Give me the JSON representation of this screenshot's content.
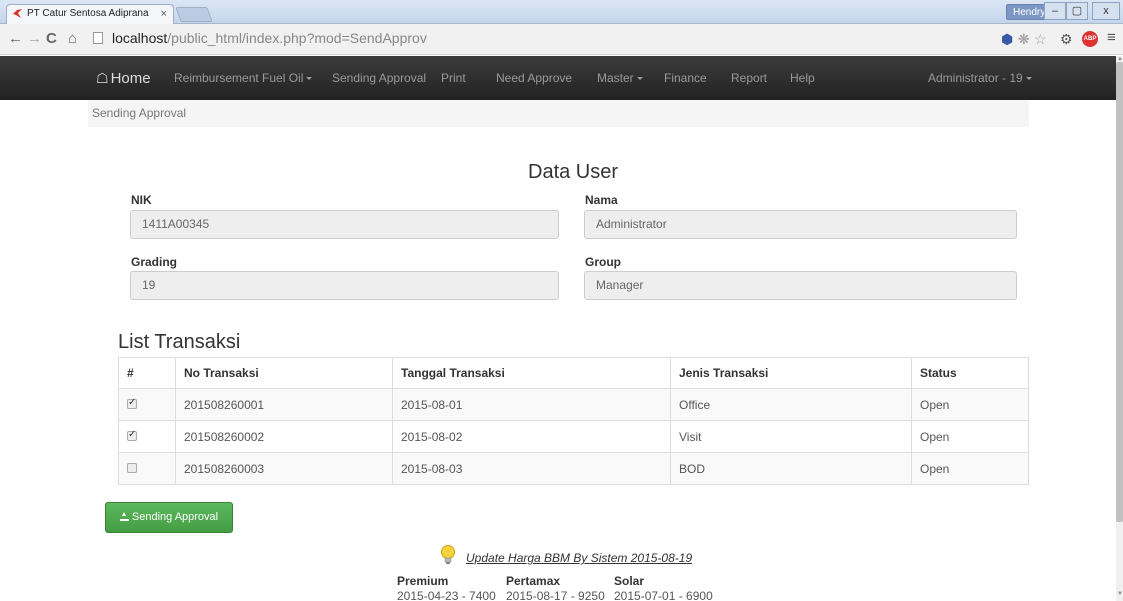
{
  "browser": {
    "tab_title": "PT Catur Sentosa Adiprana",
    "tab_close": "×",
    "user_badge": "Hendry",
    "win_min": "–",
    "win_max": "▢",
    "win_close": "x",
    "url_host": "localhost",
    "url_path": "/public_html/index.php?mod=SendApprov",
    "abp": "ABP"
  },
  "navbar": {
    "home": "Home",
    "reimbursement": "Reimbursement Fuel Oil",
    "sending_approval": "Sending Approval",
    "print": "Print",
    "need_approve": "Need Approve",
    "master": "Master",
    "finance": "Finance",
    "report": "Report",
    "help": "Help",
    "user": "Administrator - 19"
  },
  "breadcrumb": "Sending Approval",
  "data_user": {
    "title": "Data User",
    "nik_label": "NIK",
    "nik_value": "1411A00345",
    "nama_label": "Nama",
    "nama_value": "Administrator",
    "grading_label": "Grading",
    "grading_value": "19",
    "group_label": "Group",
    "group_value": "Manager"
  },
  "list": {
    "title": "List Transaksi",
    "columns": [
      "#",
      "No Transaksi",
      "Tanggal Transaksi",
      "Jenis Transaksi",
      "Status"
    ],
    "rows": [
      {
        "checked": true,
        "no": "201508260001",
        "tanggal": "2015-08-01",
        "jenis": "Office",
        "status": "Open"
      },
      {
        "checked": true,
        "no": "201508260002",
        "tanggal": "2015-08-02",
        "jenis": "Visit",
        "status": "Open"
      },
      {
        "checked": false,
        "no": "201508260003",
        "tanggal": "2015-08-03",
        "jenis": "BOD",
        "status": "Open"
      }
    ]
  },
  "send_button": "Sending Approval",
  "bbm": {
    "update_text": "Update Harga BBM By Sistem 2015-08-19",
    "premium_label": "Premium",
    "pertamax_label": "Pertamax",
    "solar_label": "Solar",
    "premium_value": "2015-04-23 - 7400",
    "pertamax_value": "2015-08-17 - 9250",
    "solar_value": "2015-07-01 - 6900"
  },
  "colors": {
    "navbar": "#222222",
    "success": "#5cb85c"
  }
}
